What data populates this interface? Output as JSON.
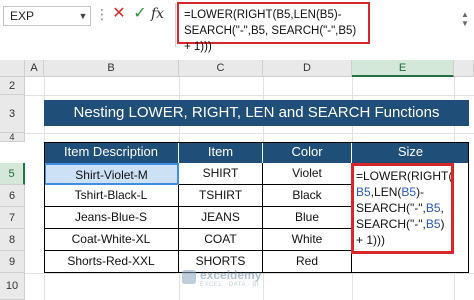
{
  "formula_bar": {
    "name_box": "EXP",
    "more_icon": "⋮",
    "cancel_icon": "✕",
    "enter_icon": "✓",
    "fx_label": "fx",
    "formula_line1": "=LOWER(RIGHT(B5,LEN(B5)-",
    "formula_line2": "SEARCH(\"-\",B5, SEARCH(\"-\",B5) + 1)))"
  },
  "columns": [
    "A",
    "B",
    "C",
    "D",
    "E"
  ],
  "rows": [
    "2",
    "3",
    "4",
    "5",
    "6",
    "7",
    "8",
    "9",
    "10"
  ],
  "title": "Nesting LOWER, RIGHT, LEN and SEARCH Functions",
  "table": {
    "headers": [
      "Item Description",
      "Item",
      "Color",
      "Size"
    ],
    "rows": [
      {
        "description": "Shirt-Violet-M",
        "item": "SHIRT",
        "color": "Violet"
      },
      {
        "description": "Tshirt-Black-L",
        "item": "TSHIRT",
        "color": "Black"
      },
      {
        "description": "Jeans-Blue-S",
        "item": "JEANS",
        "color": "Blue"
      },
      {
        "description": "Coat-White-XL",
        "item": "COAT",
        "color": "White"
      },
      {
        "description": "Shorts-Red-XXL",
        "item": "SHORTS",
        "color": "Red"
      }
    ]
  },
  "edit_cell": {
    "parts": [
      "=LOWER(RIGHT(",
      "B5",
      ",LEN(",
      "B5",
      ")-",
      "SEARCH(\"-\",",
      "B5",
      ",",
      "SEARCH(\"-\",",
      "B5",
      ")",
      "+ 1)))"
    ]
  },
  "watermark": {
    "brand": "exceldemy",
    "tagline": "EXCEL · DATA · BI"
  },
  "colors": {
    "accent": "#1f4e79",
    "highlight": "#d9262a",
    "reference": "#2a5db0",
    "selected_fill": "#cce1f5"
  }
}
